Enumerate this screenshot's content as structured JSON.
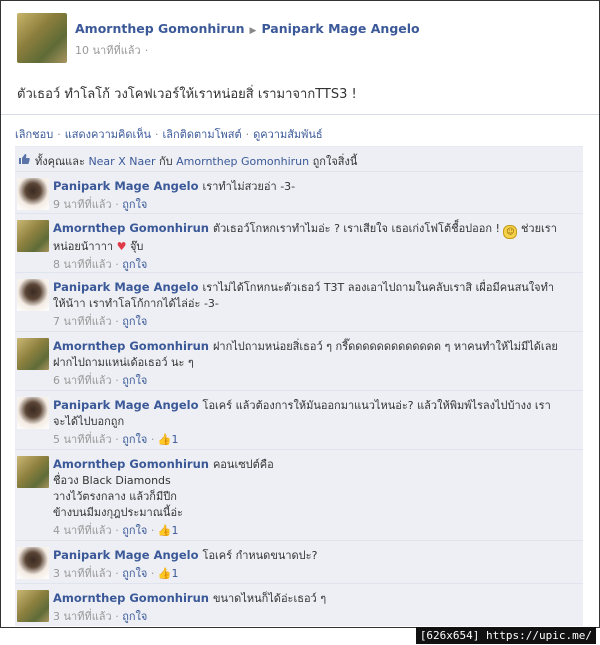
{
  "post": {
    "author": "Amornthep Gomonhirun",
    "target": "Panipark Mage Angelo",
    "arrow": "▶",
    "time": "10 นาทีที่แล้ว",
    "time_dot": "·",
    "text": "ตัวเธอว์ ทำโลโก้ วงโคฟเวอร์ให้เราหน่อยสิ่ เรามาจากTTS3 !"
  },
  "actions": {
    "unlike": "เลิกชอบ",
    "show_comments": "แสดงความคิดเห็น",
    "unfollow": "เลิกติดตามโพสต์",
    "see_friendship": "ดูความสัมพันธ์",
    "sep": "·"
  },
  "likes": {
    "thumb_icon": "thumbs-up-icon",
    "prefix": "ทั้งคุณและ",
    "person1": "Near X Naer",
    "mid": "กับ",
    "person2": "Amornthep Gomonhirun",
    "suffix": "ถูกใจสิ่งนี้"
  },
  "comments": [
    {
      "author": "Panipark Mage Angelo",
      "text": "เราทำไม่สวยอ่า -3-",
      "time": "9 นาทีที่แล้ว",
      "like": "ถูกใจ",
      "count": ""
    },
    {
      "author": "Amornthep Gomonhirun",
      "text": "ตัวเธอว์โกหกเราทำไมอ่ะ ? เราเสียใจ เธอเก่งโฟโต้ชื็อปออก !",
      "text2": "ช่วยเรา",
      "text3": "หน่อยน้าาาา",
      "text4": "จุ๊บ",
      "time": "8 นาทีที่แล้ว",
      "like": "ถูกใจ",
      "count": ""
    },
    {
      "author": "Panipark Mage Angelo",
      "text": "เราไม่ได้โกหกนะตัวเธอว์ T3T ลองเอาไปถามในคลับเราสิ เผื่อมีคนสนใจทำ",
      "text2": "ให้น้าา เราทำโลโก้กากได้ไล่อ่ะ -3-",
      "time": "7 นาทีที่แล้ว",
      "like": "ถูกใจ",
      "count": ""
    },
    {
      "author": "Amornthep Gomonhirun",
      "text": "ฝากไปถามหน่อยสิ่เธอว์ ๆ กรี๊ดดดดดดดดดดดดด ๆ หาคนทำให้ไม่มีได้เลย",
      "text2": "ฝากไปถามแหน่เด้อเธอว์ นะ ๆ",
      "time": "6 นาทีที่แล้ว",
      "like": "ถูกใจ",
      "count": ""
    },
    {
      "author": "Panipark Mage Angelo",
      "text": "โอเคร์ แล้วต้องการให้มันออกมาแนวไหนอ่ะ? แล้วให้พิมพ์ไรลงไปบ้างง เรา",
      "text2": "จะได้ไปบอกถูก",
      "time": "5 นาทีที่แล้ว",
      "like": "ถูกใจ",
      "count": "1"
    },
    {
      "author": "Amornthep Gomonhirun",
      "text": "คอนเซปต์คือ",
      "text2": "ชื่อวง Black Diamonds",
      "text3": "วางไว้ตรงกลาง แล้วก็มีปีก",
      "text4": "ข้างบนมีมงกุฎประมาณนี้อ่ะ",
      "time": "4 นาทีที่แล้ว",
      "like": "ถูกใจ",
      "count": "1"
    },
    {
      "author": "Panipark Mage Angelo",
      "text": "โอเคร์ กำหนดขนาดปะ?",
      "time": "3 นาทีที่แล้ว",
      "like": "ถูกใจ",
      "count": "1"
    },
    {
      "author": "Amornthep Gomonhirun",
      "text": "ขนาดไหนก็ได้อ่ะเธอว์ ๆ",
      "time": "3 นาทีที่แล้ว",
      "like": "ถูกใจ",
      "count": ""
    }
  ],
  "footer": "[626x654] https://upic.me/"
}
